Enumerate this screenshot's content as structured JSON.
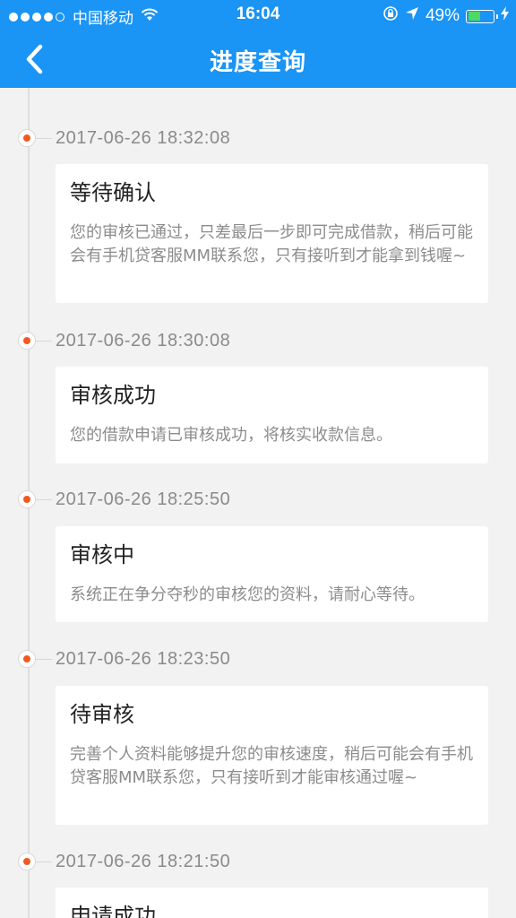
{
  "status_bar": {
    "carrier": "中国移动",
    "time": "16:04",
    "battery": "49%",
    "battery_level": 0.49
  },
  "nav": {
    "title": "进度查询",
    "back_icon": "chevron-left-icon"
  },
  "entries": [
    {
      "time": "2017-06-26 18:32:08",
      "title": "等待确认",
      "desc": "您的审核已通过，只差最后一步即可完成借款，稍后可能会有手机贷客服MM联系您，只有接听到才能拿到钱喔~"
    },
    {
      "time": "2017-06-26 18:30:08",
      "title": "审核成功",
      "desc": "您的借款申请已审核成功，将核实收款信息。"
    },
    {
      "time": "2017-06-26 18:25:50",
      "title": "审核中",
      "desc": "系统正在争分夺秒的审核您的资料，请耐心等待。"
    },
    {
      "time": "2017-06-26 18:23:50",
      "title": "待审核",
      "desc": "完善个人资料能够提升您的审核速度，稍后可能会有手机贷客服MM联系您，只有接听到才能审核通过喔~"
    },
    {
      "time": "2017-06-26 18:21:50",
      "title": "申请成功",
      "desc": ""
    }
  ],
  "colors": {
    "primary": "#1a94f5",
    "node": "#f05a22"
  }
}
